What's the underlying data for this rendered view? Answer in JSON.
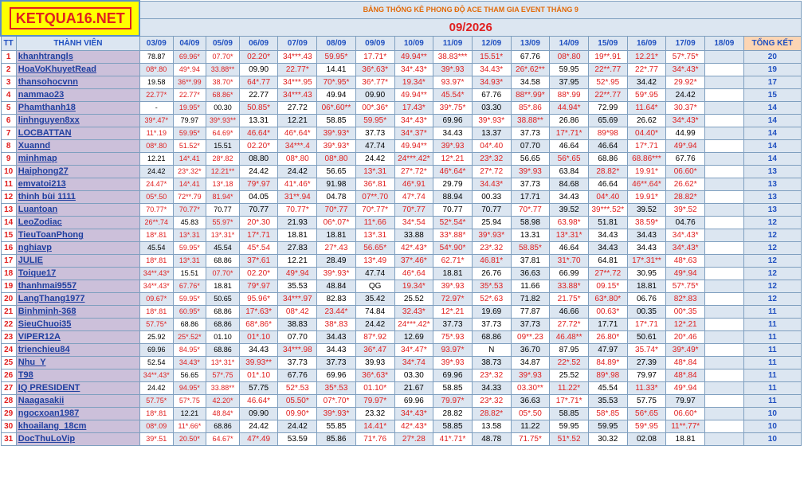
{
  "site_logo": "KETQUA16.NET",
  "title_line1": "BẢNG THỐNG KÊ PHONG ĐỘ ACE THAM GIA EVENT THÁNG 9",
  "title_line2": "09/2026",
  "headers": {
    "tt": "TT",
    "member": "THÀNH VIÊN",
    "total": "TỔNG KẾT",
    "dates": [
      "03/09",
      "04/09",
      "05/09",
      "06/09",
      "07/09",
      "08/09",
      "09/09",
      "10/09",
      "11/09",
      "12/09",
      "13/09",
      "14/09",
      "15/09",
      "16/09",
      "17/09",
      "18/09"
    ]
  },
  "rows": [
    {
      "tt": "1",
      "name": "khanhtrangls",
      "total": "20",
      "cells": [
        "78.87",
        "69.96*",
        "07.70*",
        "02.20*",
        "34***.43",
        "59.95*",
        "17.71*",
        "49.94**",
        "38.83***",
        "15.51*",
        "67.76",
        "08*.80",
        "19**.91",
        "12.21*",
        "57*.75*",
        ""
      ]
    },
    {
      "tt": "2",
      "name": "HoaVoKhuyetRead",
      "total": "19",
      "cells": [
        "08*.80",
        "49*.94",
        "33.88**",
        "09.90",
        "22.77*",
        "14.41",
        "36*.63*",
        "34*.43*",
        "39*.93",
        "34.43*",
        "26*.62**",
        "59.95",
        "22**.77",
        "22*.77",
        "34*.43*",
        ""
      ]
    },
    {
      "tt": "3",
      "name": "thansohocvnn",
      "total": "17",
      "cells": [
        "19.58",
        "36**.99",
        "38.70*",
        "64*.77",
        "34***.95",
        "70*.95*",
        "36*.77*",
        "19.34*",
        "93.97*",
        "34.93*",
        "34.58",
        "37.95",
        "52*.95",
        "34.42",
        "29.92*",
        ""
      ]
    },
    {
      "tt": "4",
      "name": "nammao23",
      "total": "15",
      "cells": [
        "22.77*",
        "22.77*",
        "68.86*",
        "22.77",
        "34***.43",
        "49.94",
        "09.90",
        "49.94**",
        "45.54*",
        "67.76",
        "88**.99*",
        "88*.99",
        "22**.77",
        "59*.95",
        "24.42",
        ""
      ]
    },
    {
      "tt": "5",
      "name": "Phamthanh18",
      "total": "14",
      "cells": [
        "-",
        "19.95*",
        "00.30",
        "50.85*",
        "27.72",
        "06*.60**",
        "00*.36*",
        "17.43*",
        "39*.75*",
        "03.30",
        "85*.86",
        "44.94*",
        "72.99",
        "11.64*",
        "30.37*",
        ""
      ]
    },
    {
      "tt": "6",
      "name": "linhnguyen8xx",
      "total": "14",
      "cells": [
        "39*.47*",
        "79.97",
        "39*.93**",
        "13.31",
        "12.21",
        "58.85",
        "59.95*",
        "34*.43*",
        "69.96",
        "39*.93*",
        "38.88**",
        "26.86",
        "65.69",
        "26.62",
        "34*.43*",
        ""
      ]
    },
    {
      "tt": "7",
      "name": "LOCBATTAN",
      "total": "14",
      "cells": [
        "11*.19",
        "59.95*",
        "64.69*",
        "46.64*",
        "46*.64*",
        "39*.93*",
        "37.73",
        "34*.37*",
        "34.43",
        "13.37",
        "37.73",
        "17*.71*",
        "89*98",
        "04.40*",
        "44.99",
        ""
      ]
    },
    {
      "tt": "8",
      "name": "Xuannd",
      "total": "14",
      "cells": [
        "08*.80",
        "51.52*",
        "15.51",
        "02.20*",
        "34***.4",
        "39*.93*",
        "47.74",
        "49.94**",
        "39*.93",
        "04*.40",
        "07.70",
        "46.64",
        "46.64",
        "17*.71",
        "49*.94",
        ""
      ]
    },
    {
      "tt": "9",
      "name": "minhmap",
      "total": "14",
      "cells": [
        "12.21",
        "14*.41",
        "28*.82",
        "08.80",
        "08*.80",
        "08*.80",
        "24.42",
        "24***.42*",
        "12*.21",
        "23*.32",
        "56.65",
        "56*.65",
        "68.86",
        "68.86***",
        "67.76",
        ""
      ]
    },
    {
      "tt": "10",
      "name": "Haiphong27",
      "total": "13",
      "cells": [
        "24.42",
        "23*.32*",
        "12.21**",
        "24.42",
        "24.42",
        "56.65",
        "13*.31",
        "27*.72*",
        "46*.64*",
        "27*.72",
        "39*.93",
        "63.84",
        "28.82*",
        "19.91*",
        "06.60*",
        ""
      ]
    },
    {
      "tt": "11",
      "name": "emvatoi213",
      "total": "13",
      "cells": [
        "24.47*",
        "14*.41",
        "13*.18",
        "79*.97",
        "41*.46*",
        "91.98",
        "36*.81",
        "46*.91",
        "29.79",
        "34.43*",
        "37.73",
        "84.68",
        "46.64",
        "46**.64*",
        "26.62*",
        ""
      ]
    },
    {
      "tt": "12",
      "name": "thinh bùi 1111",
      "total": "13",
      "cells": [
        "05*.50",
        "72**.79",
        "81.94*",
        "04.05",
        "31**.94",
        "04.78",
        "07**.70",
        "47*.74",
        "88.94",
        "00.33",
        "17.71",
        "34.43",
        "04*.40",
        "19.91*",
        "28.82*",
        ""
      ]
    },
    {
      "tt": "13",
      "name": "Luantoan",
      "total": "13",
      "cells": [
        "70.77*",
        "70.77*",
        "70.77",
        "70.77",
        "70.77*",
        "70*.77",
        "70*.77*",
        "70*.77",
        "70.77",
        "70.77",
        "70*.77",
        "39.52",
        "39***.52*",
        "39.52",
        "39*.52",
        ""
      ]
    },
    {
      "tt": "14",
      "name": "LeoZodiac",
      "total": "12",
      "cells": [
        "26**.74",
        "45.83",
        "55.97*",
        "20*.30",
        "21.93",
        "06*.07*",
        "11*.66",
        "34*.54",
        "52*.54*",
        "25.94",
        "58.98",
        "63.98*",
        "51.81",
        "38.59*",
        "04.76",
        ""
      ]
    },
    {
      "tt": "15",
      "name": "TieuToanPhong",
      "total": "12",
      "cells": [
        "18*.81",
        "13*.31",
        "13*.31*",
        "17*.71",
        "18.81",
        "18.81",
        "13*.31",
        "33.88",
        "33*.88*",
        "39*.93*",
        "13.31",
        "13*.31*",
        "34.43",
        "34.43",
        "34*.43*",
        ""
      ]
    },
    {
      "tt": "16",
      "name": "nghiavp",
      "total": "12",
      "cells": [
        "45.54",
        "59.95*",
        "45.54",
        "45*.54",
        "27.83",
        "27*.43",
        "56.65*",
        "42*.43*",
        "54*.90*",
        "23*.32",
        "58.85*",
        "46.64",
        "34.43",
        "34.43",
        "34*.43*",
        ""
      ]
    },
    {
      "tt": "17",
      "name": "JULIE",
      "total": "12",
      "cells": [
        "18*.81",
        "13*.31",
        "68.86",
        "37*.61",
        "12.21",
        "28.49",
        "13*.49",
        "37*.46*",
        "62.71*",
        "46.81*",
        "37.81",
        "31*.70",
        "64.81",
        "17*.31**",
        "48*.63",
        ""
      ]
    },
    {
      "tt": "18",
      "name": "Toique17",
      "total": "12",
      "cells": [
        "34**.43*",
        "15.51",
        "07.70*",
        "02.20*",
        "49*.94",
        "39*.93*",
        "47.74",
        "46*.64",
        "18.81",
        "26.76",
        "36.63",
        "66.99",
        "27**.72",
        "30.95",
        "49*.94",
        ""
      ]
    },
    {
      "tt": "19",
      "name": "thanhmai9557",
      "total": "12",
      "cells": [
        "34**.43*",
        "67.76*",
        "18.81",
        "79*.97",
        "35.53",
        "48.84",
        "QG",
        "19.34*",
        "39*.93",
        "35*.53",
        "11.66",
        "33.88*",
        "09.15*",
        "18.81",
        "57*.75*",
        ""
      ]
    },
    {
      "tt": "20",
      "name": "LangThang1977",
      "total": "12",
      "cells": [
        "09.67*",
        "59.95*",
        "50.65",
        "95.96*",
        "34***.97",
        "82.83",
        "35.42",
        "25.52",
        "72.97*",
        "52*.63",
        "71.82",
        "21.75*",
        "63*.80*",
        "06.76",
        "82*.83",
        ""
      ]
    },
    {
      "tt": "21",
      "name": "Binhminh-368",
      "total": "11",
      "cells": [
        "18*.81",
        "60.95*",
        "68.86",
        "17*.63*",
        "08*.42",
        "23.44*",
        "74.84",
        "32.43*",
        "12*.21",
        "19.69",
        "77.87",
        "46.66",
        "00.63*",
        "00.35",
        "00*.35",
        ""
      ]
    },
    {
      "tt": "22",
      "name": "SieuChuoi35",
      "total": "11",
      "cells": [
        "57.75*",
        "68.86",
        "68.86",
        "68*.86*",
        "38.83",
        "38*.83",
        "24.42",
        "24***.42*",
        "37.73",
        "37.73",
        "37.73",
        "27.72*",
        "17.71",
        "17*.71",
        "12*.21",
        ""
      ]
    },
    {
      "tt": "23",
      "name": "VIPER12A",
      "total": "11",
      "cells": [
        "25.92",
        "25*.52*",
        "01.10",
        "01*.10",
        "07.70",
        "34.43",
        "87*.92",
        "12.69",
        "75*.93",
        "68.86",
        "09**.23",
        "46.48**",
        "26.80*",
        "50.61",
        "20*.46",
        ""
      ]
    },
    {
      "tt": "24",
      "name": "trienchieu84",
      "total": "11",
      "cells": [
        "69.96",
        "84.95*",
        "68.86",
        "34.43",
        "34***.98",
        "34.43",
        "36*.47",
        "34*.47*",
        "93.97*",
        "N",
        "36.70",
        "87.95",
        "47.97",
        "35.74*",
        "39*.49*",
        ""
      ]
    },
    {
      "tt": "25",
      "name": "Nhu_Y",
      "total": "11",
      "cells": [
        "52.54",
        "34.43*",
        "13*.31*",
        "39.93**",
        "37.73",
        "37.73",
        "39.93",
        "34*.74",
        "39*.93",
        "38.73",
        "34.87",
        "22*.52",
        "84.89*",
        "27.39",
        "48*.84",
        ""
      ]
    },
    {
      "tt": "26",
      "name": "T98",
      "total": "11",
      "cells": [
        "34**.43*",
        "56.65",
        "57*.75",
        "01*.10",
        "67.76",
        "69.96",
        "36*.63*",
        "03.30",
        "69.96",
        "23*.32",
        "39*.93",
        "25.52",
        "89*.98",
        "79.97",
        "48*.84",
        ""
      ]
    },
    {
      "tt": "27",
      "name": "IQ PRESIDENT",
      "total": "11",
      "cells": [
        "24.42",
        "94.95*",
        "33.88**",
        "57.75",
        "52*.53",
        "35*.53",
        "01.10*",
        "21.67",
        "58.85",
        "34.33",
        "03.30**",
        "11.22*",
        "45.54",
        "11.33*",
        "49*.94",
        ""
      ]
    },
    {
      "tt": "28",
      "name": "Naagasakii",
      "total": "11",
      "cells": [
        "57.75*",
        "57*.75",
        "42.20*",
        "46.64*",
        "05.50*",
        "07*.70*",
        "79.97*",
        "69.96",
        "79.97*",
        "23*.32",
        "36.63",
        "17*.71*",
        "35.53",
        "57.75",
        "79.97",
        ""
      ]
    },
    {
      "tt": "29",
      "name": "ngocxoan1987",
      "total": "10",
      "cells": [
        "18*.81",
        "12.21",
        "48.84*",
        "09.90",
        "09.90*",
        "39*.93*",
        "23.32",
        "34*.43*",
        "28.82",
        "28.82*",
        "05*.50",
        "58.85",
        "58*.85",
        "56*.65",
        "06.60*",
        ""
      ]
    },
    {
      "tt": "30",
      "name": "khoailang_18cm",
      "total": "10",
      "cells": [
        "08*.09",
        "11*.66*",
        "68.86",
        "24.42",
        "24.42",
        "55.85",
        "14.41*",
        "42*.43*",
        "58.85",
        "13.58",
        "11.22",
        "59.95",
        "59.95",
        "59*.95",
        "11**.77*",
        ""
      ]
    },
    {
      "tt": "31",
      "name": "DocThuLoVip",
      "total": "10",
      "cells": [
        "39*.51",
        "20.50*",
        "64.67*",
        "47*.49",
        "53.59",
        "85.86",
        "71*.76",
        "27*.28",
        "41*.71*",
        "48.78",
        "71.75*",
        "51*.52",
        "30.32",
        "02.08",
        "18.81",
        ""
      ]
    }
  ]
}
